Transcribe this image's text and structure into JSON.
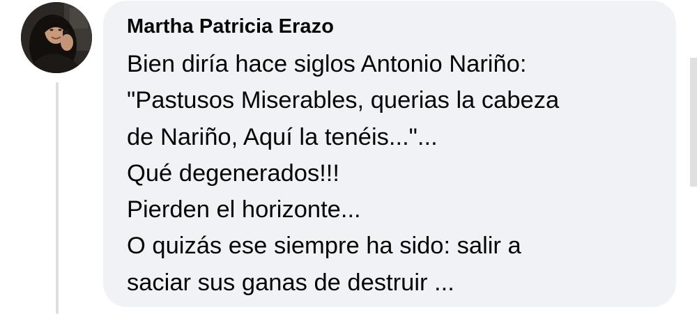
{
  "comment": {
    "author": "Martha Patricia Erazo",
    "lines": [
      "Bien diría hace siglos Antonio Nariño:",
      "\"Pastusos Miserables, querias la cabeza",
      "de Nariño, Aquí la tenéis...\"...",
      "Qué degenerados!!!",
      "Pierden el horizonte...",
      "O quizás ese siempre ha sido: salir a",
      "saciar sus ganas de destruir ..."
    ]
  },
  "colors": {
    "bubble_background": "#f0f2f5",
    "text": "#050505",
    "thread_line": "#dcdee2"
  }
}
